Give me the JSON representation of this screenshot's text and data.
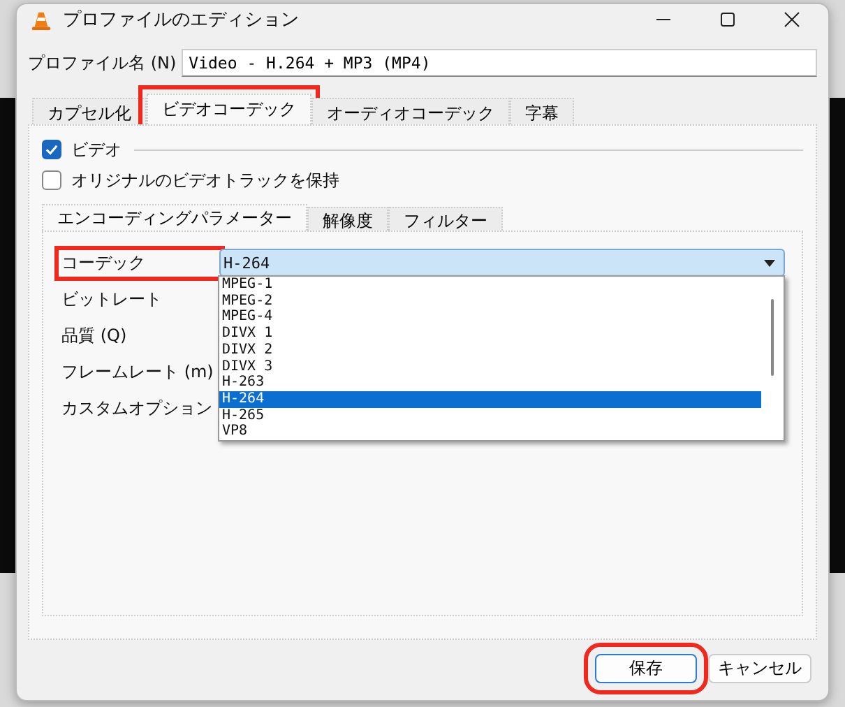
{
  "window": {
    "title": "プロファイルのエディション"
  },
  "profile_name": {
    "label": "プロファイル名 (N)",
    "value": "Video - H.264 + MP3 (MP4)"
  },
  "tabs": [
    {
      "label": "カプセル化",
      "selected": false,
      "highlighted": false
    },
    {
      "label": "ビデオコーデック",
      "selected": true,
      "highlighted": true
    },
    {
      "label": "オーディオコーデック",
      "selected": false,
      "highlighted": false
    },
    {
      "label": "字幕",
      "selected": false,
      "highlighted": false
    }
  ],
  "video_group": {
    "label": "ビデオ",
    "checked": true
  },
  "keep_original": {
    "label": "オリジナルのビデオトラックを保持",
    "checked": false
  },
  "subtabs": [
    {
      "label": "エンコーディングパラメーター",
      "selected": true
    },
    {
      "label": "解像度",
      "selected": false
    },
    {
      "label": "フィルター",
      "selected": false
    }
  ],
  "fields": [
    {
      "label": "コーデック",
      "highlighted": true
    },
    {
      "label": "ビットレート",
      "highlighted": false
    },
    {
      "label": "品質 (Q)",
      "highlighted": false
    },
    {
      "label": "フレームレート (m)",
      "highlighted": false
    },
    {
      "label": "カスタムオプション",
      "highlighted": false
    }
  ],
  "codec": {
    "value": "H-264",
    "expanded": true,
    "options": [
      {
        "label": "MPEG-1",
        "selected": false
      },
      {
        "label": "MPEG-2",
        "selected": false
      },
      {
        "label": "MPEG-4",
        "selected": false
      },
      {
        "label": "DIVX 1",
        "selected": false
      },
      {
        "label": "DIVX 2",
        "selected": false
      },
      {
        "label": "DIVX 3",
        "selected": false
      },
      {
        "label": "H-263",
        "selected": false
      },
      {
        "label": "H-264",
        "selected": true
      },
      {
        "label": "H-265",
        "selected": false
      },
      {
        "label": "VP8",
        "selected": false
      }
    ]
  },
  "buttons": [
    {
      "label": "保存",
      "kind": "default",
      "highlighted": true
    },
    {
      "label": "キャンセル",
      "kind": "normal",
      "highlighted": false
    }
  ]
}
